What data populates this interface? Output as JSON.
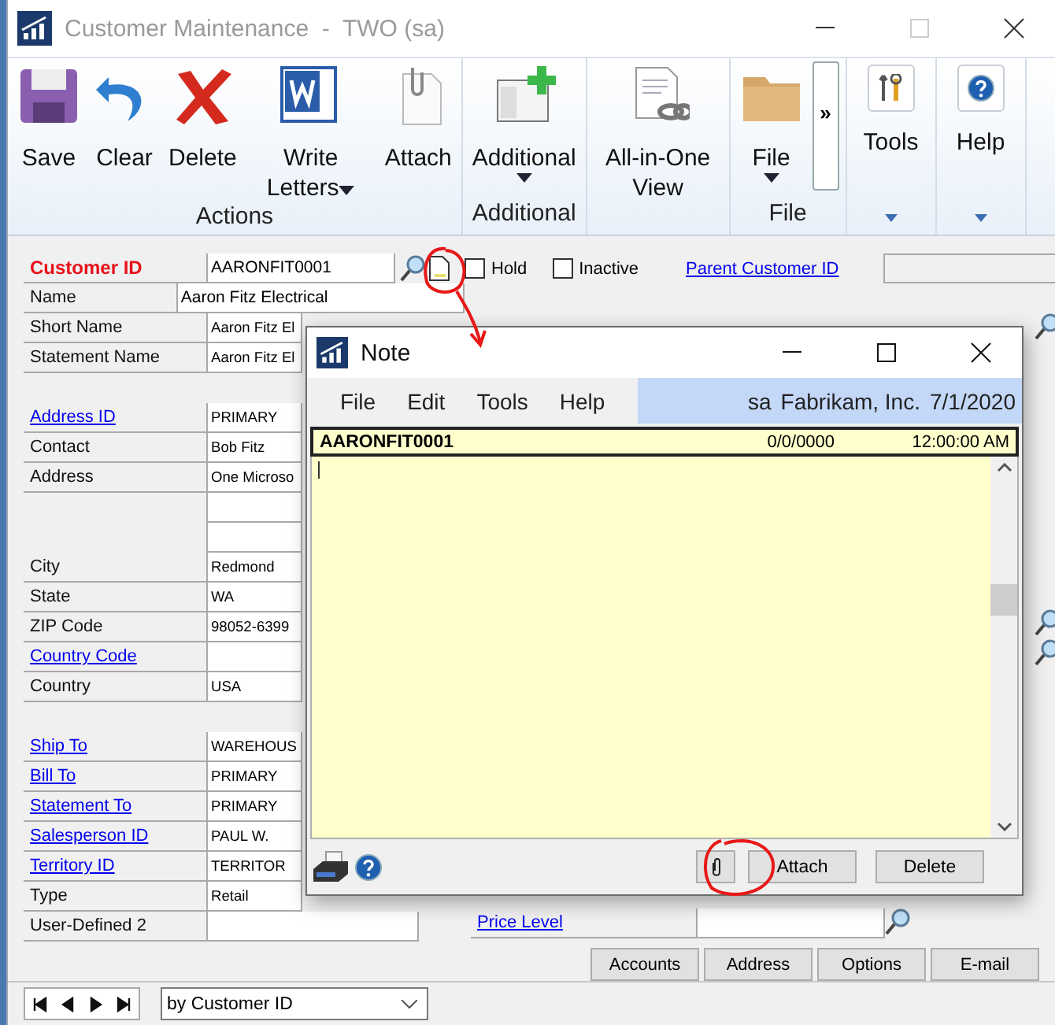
{
  "window": {
    "title": "Customer Maintenance  -  TWO (sa)"
  },
  "ribbon": {
    "groups": [
      {
        "label": "Actions",
        "buttons": [
          {
            "label": "Save"
          },
          {
            "label": "Clear"
          },
          {
            "label": "Delete"
          },
          {
            "label": "Write Letters",
            "dropdown": true
          },
          {
            "label": "Attach"
          }
        ]
      },
      {
        "label": "Additional",
        "buttons": [
          {
            "label": "Additional",
            "dropdown": true
          }
        ]
      },
      {
        "buttons": [
          {
            "label": "All-in-One View"
          }
        ]
      },
      {
        "label": "File",
        "buttons": [
          {
            "label": "File",
            "dropdown": true
          }
        ],
        "overflow": "»"
      },
      {
        "kind": "compact",
        "buttons": [
          {
            "label": "Tools"
          }
        ]
      },
      {
        "kind": "compact",
        "buttons": [
          {
            "label": "Help"
          }
        ]
      }
    ]
  },
  "form": {
    "customer": {
      "label": "Customer ID",
      "value": "AARONFIT0001"
    },
    "flags": [
      {
        "label": "Hold",
        "checked": false
      },
      {
        "label": "Inactive",
        "checked": false
      }
    ],
    "parent": {
      "label": "Parent Customer ID"
    },
    "sections": [
      [
        {
          "kind": "field",
          "label": "Name",
          "link": false,
          "value": "Aaron Fitz Electrical"
        },
        {
          "kind": "field",
          "label": "Short Name",
          "link": false,
          "value": "Aaron Fitz El"
        },
        {
          "kind": "field",
          "label": "Statement Name",
          "link": false,
          "value": "Aaron Fitz El"
        }
      ],
      [
        {
          "kind": "field",
          "label": "Address ID",
          "link": true,
          "value": "PRIMARY"
        },
        {
          "kind": "field",
          "label": "Contact",
          "link": false,
          "value": "Bob Fitz"
        },
        {
          "kind": "field",
          "label": "Address",
          "link": false,
          "value": "One Microso"
        },
        {
          "kind": "blank"
        },
        {
          "kind": "blank"
        },
        {
          "kind": "field",
          "label": "City",
          "link": false,
          "value": "Redmond"
        },
        {
          "kind": "field",
          "label": "State",
          "link": false,
          "value": "WA"
        },
        {
          "kind": "field",
          "label": "ZIP Code",
          "link": false,
          "value": "98052-6399"
        },
        {
          "kind": "field",
          "label": "Country Code",
          "link": true
        },
        {
          "kind": "field",
          "label": "Country",
          "link": false,
          "value": "USA"
        }
      ],
      [
        {
          "kind": "field",
          "label": "Ship To",
          "link": true,
          "value": "WAREHOUS"
        },
        {
          "kind": "field",
          "label": "Bill To",
          "link": true,
          "value": "PRIMARY"
        },
        {
          "kind": "field",
          "label": "Statement To",
          "link": true,
          "value": "PRIMARY"
        },
        {
          "kind": "field",
          "label": "Salesperson ID",
          "link": true,
          "value": "PAUL W."
        },
        {
          "kind": "field",
          "label": "Territory ID",
          "link": true,
          "value": "TERRITOR"
        },
        {
          "kind": "field",
          "label": "Type",
          "link": false,
          "value": "Retail"
        },
        {
          "kind": "field",
          "label": "User-Defined 2",
          "link": false
        }
      ]
    ],
    "price_level": {
      "label": "Price Level"
    },
    "buttons": [
      {
        "label": "Accounts"
      },
      {
        "label": "Address"
      },
      {
        "label": "Options"
      },
      {
        "label": "E-mail"
      }
    ]
  },
  "browse": {
    "sort": "by Customer ID"
  },
  "note": {
    "title": "Note",
    "menu": [
      {
        "label": "File"
      },
      {
        "label": "Edit"
      },
      {
        "label": "Tools"
      },
      {
        "label": "Help"
      }
    ],
    "session": {
      "user": "sa",
      "company": "Fabrikam, Inc.",
      "date": "7/1/2020"
    },
    "record": {
      "id": "AARONFIT0001",
      "date": "0/0/0000",
      "time": "12:00:00 AM"
    },
    "buttons": [
      {
        "label": "Attach"
      },
      {
        "label": "Delete"
      }
    ]
  }
}
